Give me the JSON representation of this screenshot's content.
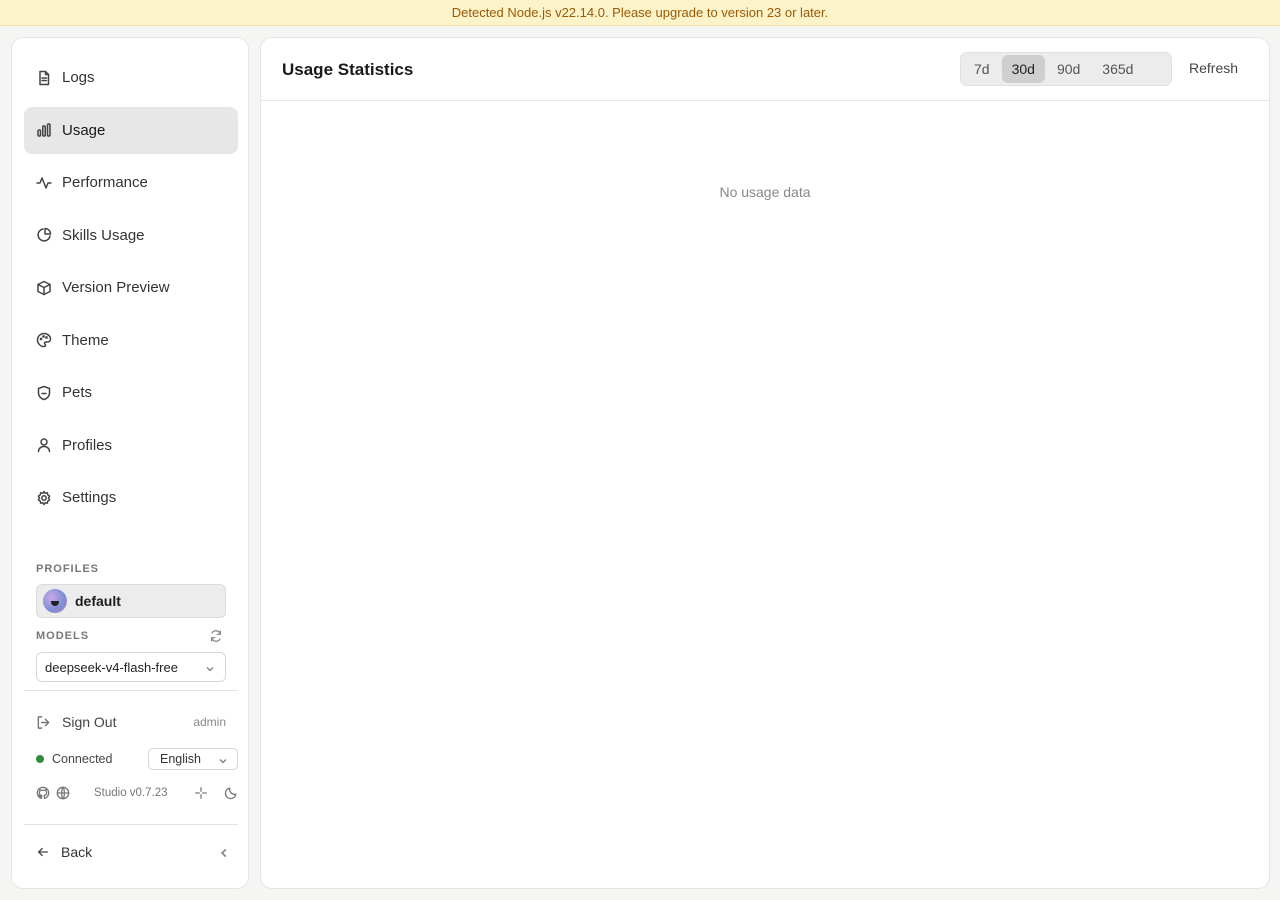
{
  "banner": {
    "message": "Detected Node.js v22.14.0. Please upgrade to version 23 or later."
  },
  "sidebar": {
    "nav": [
      {
        "label": "Logs",
        "icon": "document-icon"
      },
      {
        "label": "Usage",
        "icon": "bar-chart-icon",
        "active": true
      },
      {
        "label": "Performance",
        "icon": "activity-icon"
      },
      {
        "label": "Skills Usage",
        "icon": "pie-chart-icon"
      },
      {
        "label": "Version Preview",
        "icon": "box-icon"
      },
      {
        "label": "Theme",
        "icon": "palette-icon"
      },
      {
        "label": "Pets",
        "icon": "shield-icon"
      },
      {
        "label": "Profiles",
        "icon": "user-icon"
      },
      {
        "label": "Settings",
        "icon": "gear-icon"
      }
    ],
    "profiles_label": "PROFILES",
    "profile_name": "default",
    "models_label": "MODELS",
    "model_selected": "deepseek-v4-flash-free",
    "sign_out": "Sign Out",
    "username": "admin",
    "status": "Connected",
    "status_color": "#2e8b3a",
    "language": "English",
    "version": "Studio v0.7.23",
    "back": "Back"
  },
  "main": {
    "title": "Usage Statistics",
    "ranges": [
      "7d",
      "30d",
      "90d",
      "365d"
    ],
    "active_range": "30d",
    "refresh": "Refresh",
    "empty_message": "No usage data"
  }
}
